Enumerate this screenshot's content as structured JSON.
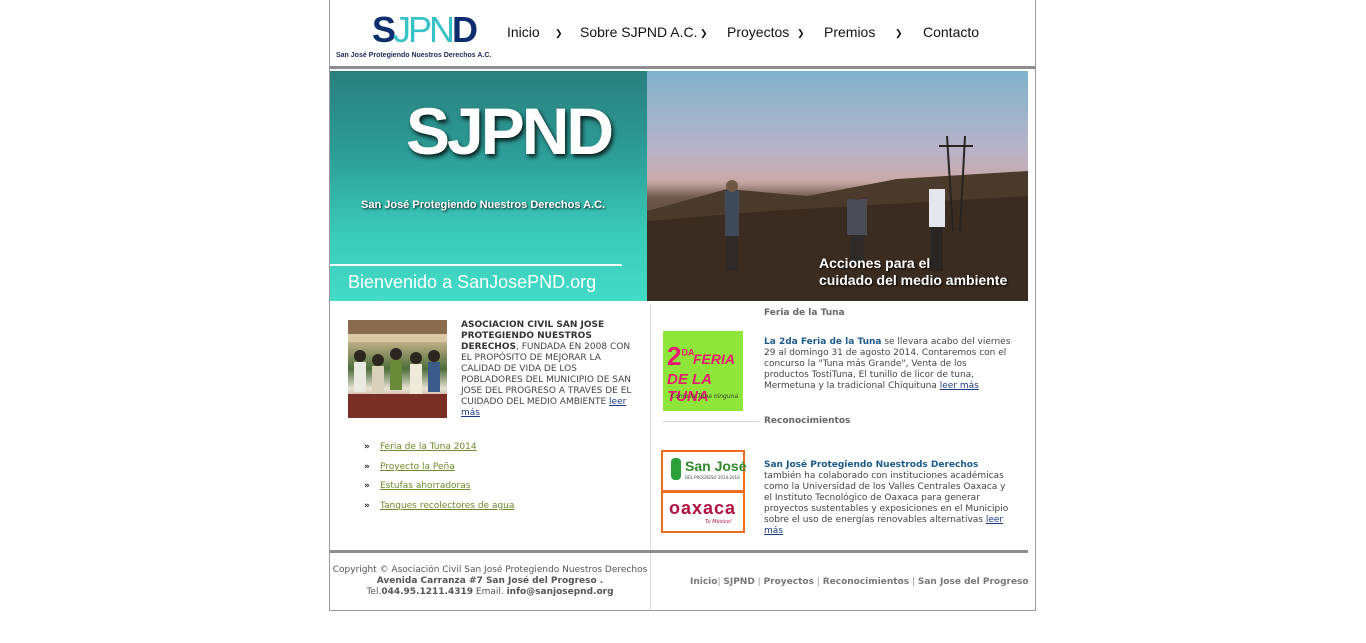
{
  "logo": {
    "mark_s": "S",
    "mark_jpn": "JPN",
    "mark_d": "D",
    "tagline": "San José Protegiendo Nuestros Derechos A.C."
  },
  "nav": {
    "items": [
      {
        "label": "Inicio",
        "has_dropdown": true
      },
      {
        "label": "Sobre SJPND A.C.",
        "has_dropdown": true
      },
      {
        "label": "Proyectos",
        "has_dropdown": true
      },
      {
        "label": "Premios",
        "has_dropdown": true
      },
      {
        "label": "Contacto",
        "has_dropdown": false
      }
    ]
  },
  "hero": {
    "big_logo": "SJPND",
    "subtitle": "San José Protegiendo Nuestros Derechos A.C.",
    "welcome": "Bienvenido a SanJosePND.org",
    "caption_line1": "Acciones para el",
    "caption_line2": "cuidado del medio ambiente"
  },
  "intro": {
    "heading": "ASOCIACION CIVIL SAN JOSE PROTEGIENDO NUESTROS DERECHOS",
    "body": ", FUNDADA EN 2008 CON EL PROPÓSITO DE MEJORAR LA CALIDAD DE VIDA DE LOS POBLADORES DEL MUNICIPIO DE SAN JOSE DEL PROGRESO A TRAVES DE EL CUIDADO DEL MEDIO AMBIENTE ",
    "more": "leer más"
  },
  "links": [
    {
      "arrow": "»",
      "label": "Feria de la Tuna 2014"
    },
    {
      "arrow": "»",
      "label": "Proyecto la Peña"
    },
    {
      "arrow": "»",
      "label": "Estufas ahorradoras"
    },
    {
      "arrow": "»",
      "label": "Tanques recolectores de agua"
    }
  ],
  "feria": {
    "section_title": "Feria de la Tuna",
    "logo_num": "2",
    "logo_sup": "DA",
    "logo_word1": "FERIA",
    "logo_word2": "DE LA TUNA",
    "logo_slogan": "Como la Tuna ninguna",
    "heading": "La 2da Feria de la Tuna",
    "body": " se llevara acabo del viernes 29 al domingo 31 de agosto 2014. Contaremos con el concurso la \"Tuna más Grande\", Venta de los productos TostiTuna, El tunillo de licor de tuna, Mermetuna y la tradicional Chiquituna ",
    "more": "leer más"
  },
  "reconocimientos": {
    "section_title": "Reconocimientos",
    "sj_logo_text": "San José",
    "sj_logo_small": "DEL PROGRESO 2014-2016",
    "oaxaca_text": "oaxaca",
    "oaxaca_small": "Tu México!",
    "heading": "San José Protegiendo Nuestrods Derechos",
    "body": " también ha colaborado con instituciones académicas como la Universidad de los Valles Centrales Oaxaca y el Instituto Tecnológico de Oaxaca para generar proyectos sustentables y exposiciones en el Municipio sobre el uso de energías renovables alternativas ",
    "more": "leer más"
  },
  "footer": {
    "copyright": "Copyright © Asociación Civil San José Protegiendo Nuestros Derechos",
    "address": "Avenida Carranza #7 San José del Progreso .",
    "tel_label": "Tel.",
    "tel": "044.95.1211.4319",
    "email_label": " Email. ",
    "email": "info@sanjosepnd.org",
    "nav": [
      "Inicio",
      "SJPND",
      "Proyectos",
      "Reconocimientos",
      "San Jose del Progreso"
    ]
  },
  "colors": {
    "teal": "#3ac9b8",
    "navy": "#0d2e6e",
    "link_green": "#6b8b2a",
    "news_blue": "#1c5a8a",
    "rule_gray": "#8e8e8e"
  }
}
